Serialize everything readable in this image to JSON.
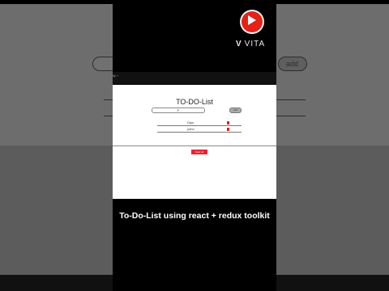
{
  "channel": {
    "logo_icon": "youtube-play-icon",
    "name": "VITA",
    "mark": "V"
  },
  "overlay": {
    "caption": "To-Do-List using react + redux toolkit"
  },
  "browser": {
    "tab_text": "lly +"
  },
  "app": {
    "title": "TO-DO-List",
    "input_value": "F",
    "add_label": "add",
    "todos": [
      {
        "text": "Dips"
      },
      {
        "text": "yoho"
      }
    ],
    "clear_label": "clear all"
  },
  "background": {
    "blur_add_label": "add"
  },
  "colors": {
    "youtube_red": "#e62117",
    "delete_red": "#dd2222",
    "clear_button": "#ee2233"
  }
}
